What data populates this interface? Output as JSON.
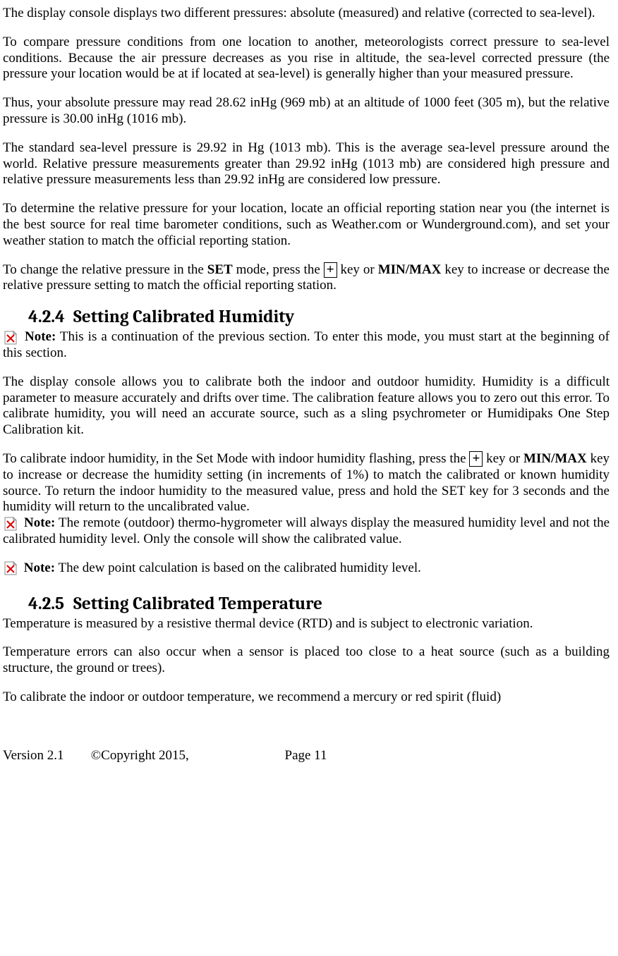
{
  "p1": "The display console displays two different pressures: absolute (measured) and relative (corrected to sea-level).",
  "p2": "To compare pressure conditions from one location to another, meteorologists correct pressure to sea-level conditions. Because the air pressure decreases as you rise in altitude, the sea-level corrected pressure (the pressure your location would be at if located at sea-level) is generally higher than your measured pressure.",
  "p3": "Thus, your absolute pressure may read 28.62 inHg (969 mb) at an altitude of 1000 feet (305 m), but the relative pressure is 30.00 inHg (1016 mb).",
  "p4": "The standard sea-level pressure is 29.92 in Hg (1013 mb). This is the average sea-level pressure around the world.  Relative pressure measurements greater than 29.92 inHg (1013 mb) are considered high pressure and relative pressure measurements less than 29.92 inHg are considered low pressure.",
  "p5": "To determine the relative pressure for your location, locate an official reporting station near you (the internet is the best source for real time barometer conditions, such as Weather.com or Wunderground.com), and set your weather station to match the official reporting station.",
  "p6a": "To change the relative pressure in the ",
  "p6_set": "SET",
  "p6b": " mode, press the ",
  "p6_plus": "+",
  "p6c": " key or ",
  "p6_minmax": "MIN/MAX",
  "p6d": " key to increase or decrease the relative pressure setting to match the official reporting station.",
  "h424_num": "4.2.4",
  "h424_title": "Setting Calibrated Humidity",
  "note1_label": "Note:",
  "note1_text": " This is a continuation of the previous section. To enter this mode, you must start at the beginning of this section.",
  "p7": "The display console allows you to calibrate both the indoor and outdoor humidity. Humidity is a difficult parameter to measure accurately and drifts over time. The calibration feature allows you to zero out this error.  To calibrate humidity, you will need an accurate source, such as a sling psychrometer or Humidipaks One Step Calibration kit.",
  "p8a": "To calibrate indoor humidity, in the Set Mode with indoor humidity flashing, press the ",
  "p8_plus": "+",
  "p8b": " key or ",
  "p8_minmax": "MIN/MAX",
  "p8c": " key to increase or decrease the humidity setting (in increments of 1%) to match the calibrated or known humidity source.   To return the indoor humidity to the measured value, press and hold the SET key for 3 seconds and the humidity will return to the uncalibrated value.",
  "note2_label": "Note:",
  "note2_text": " The remote (outdoor) thermo-hygrometer will always display the measured humidity level and not the calibrated humidity level. Only the console will show the calibrated value.",
  "note3_label": "Note:",
  "note3_text": " The dew point calculation is based on the calibrated humidity level.",
  "h425_num": "4.2.5",
  "h425_title": "Setting Calibrated Temperature",
  "p9": "Temperature is measured by a resistive thermal device (RTD) and is subject to electronic variation.",
  "p10": "Temperature errors can also occur when a sensor is placed too close to a heat source (such as a building structure, the ground or trees).",
  "p11": "To calibrate the indoor or outdoor temperature, we recommend a mercury or red spirit (fluid)",
  "footer_version": "Version 2.1",
  "footer_copy": "©Copyright 2015,",
  "footer_page": "Page 11"
}
